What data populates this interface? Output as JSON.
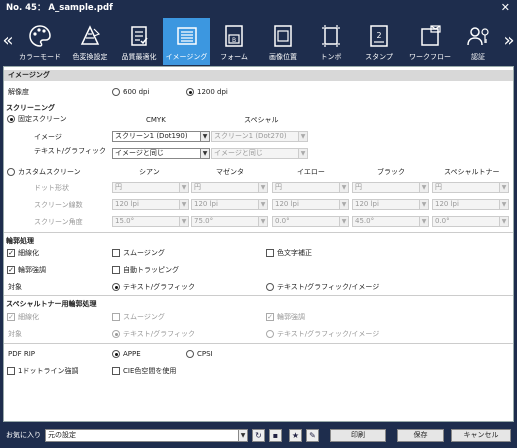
{
  "window": {
    "title": "No. 45： A_sample.pdf"
  },
  "toolbar": {
    "items": [
      {
        "label": "カラーモード",
        "icon": "palette-icon"
      },
      {
        "label": "色変換設定",
        "icon": "color-conversion-icon"
      },
      {
        "label": "品質最適化",
        "icon": "checklist-icon"
      },
      {
        "label": "イメージング",
        "icon": "imaging-icon",
        "active": true
      },
      {
        "label": "フォーム",
        "icon": "form-icon"
      },
      {
        "label": "画像位置",
        "icon": "image-position-icon"
      },
      {
        "label": "トンボ",
        "icon": "crop-marks-icon"
      },
      {
        "label": "スタンプ",
        "icon": "stamp-icon"
      },
      {
        "label": "ワークフロー",
        "icon": "workflow-icon"
      },
      {
        "label": "認証",
        "icon": "user-key-icon"
      }
    ]
  },
  "imaging": {
    "section": "イメージング",
    "res_label": "解像度",
    "res_600": "600 dpi",
    "res_1200": "1200 dpi",
    "res_selected": "1200 dpi"
  },
  "screening": {
    "title": "スクリーニング",
    "fixed_label": "固定スクリーン",
    "cmyk": "CMYK",
    "special": "スペシャル",
    "image_label": "イメージ",
    "image_cmyk": "スクリーン1 (Dot190)",
    "image_special": "スクリーン1 (Dot270)",
    "text_label": "テキスト/グラフィック",
    "text_cmyk": "イメージと同じ",
    "text_special": "イメージと同じ",
    "custom_label": "カスタムスクリーン",
    "colors": [
      "シアン",
      "マゼンタ",
      "イエロー",
      "ブラック",
      "スペシャルトナー"
    ],
    "dot_label": "ドット形状",
    "dots": [
      "円",
      "円",
      "円",
      "円",
      "円"
    ],
    "lpi_label": "スクリーン線数",
    "lpis": [
      "120 lpi",
      "120 lpi",
      "120 lpi",
      "120 lpi",
      "120 lpi"
    ],
    "angle_label": "スクリーン角度",
    "angles": [
      "15.0°",
      "75.0°",
      "0.0°",
      "45.0°",
      "0.0°"
    ]
  },
  "edge": {
    "title": "輪郭処理",
    "thin": "細線化",
    "smoothing": "スムージング",
    "color_correct": "色文字補正",
    "enhance": "輪郭強調",
    "trapping": "自動トラッピング",
    "target_label": "対象",
    "target_a": "テキスト/グラフィック",
    "target_b": "テキスト/グラフィック/イメージ"
  },
  "special_edge": {
    "title": "スペシャルトナー用輪郭処理",
    "thin": "細線化",
    "smoothing": "スムージング",
    "enhance": "輪郭強調",
    "target_label": "対象",
    "target_a": "テキスト/グラフィック",
    "target_b": "テキスト/グラフィック/イメージ"
  },
  "pdfrip": {
    "label": "PDF RIP",
    "appe": "APPE",
    "cpsi": "CPSI",
    "selected": "APPE",
    "one_dot": "1ドットライン強調",
    "cie": "CIE色空間を使用"
  },
  "footer": {
    "fav_label": "お気に入り",
    "fav_value": "元の設定",
    "print": "印刷",
    "save": "保存",
    "cancel": "キャンセル"
  }
}
